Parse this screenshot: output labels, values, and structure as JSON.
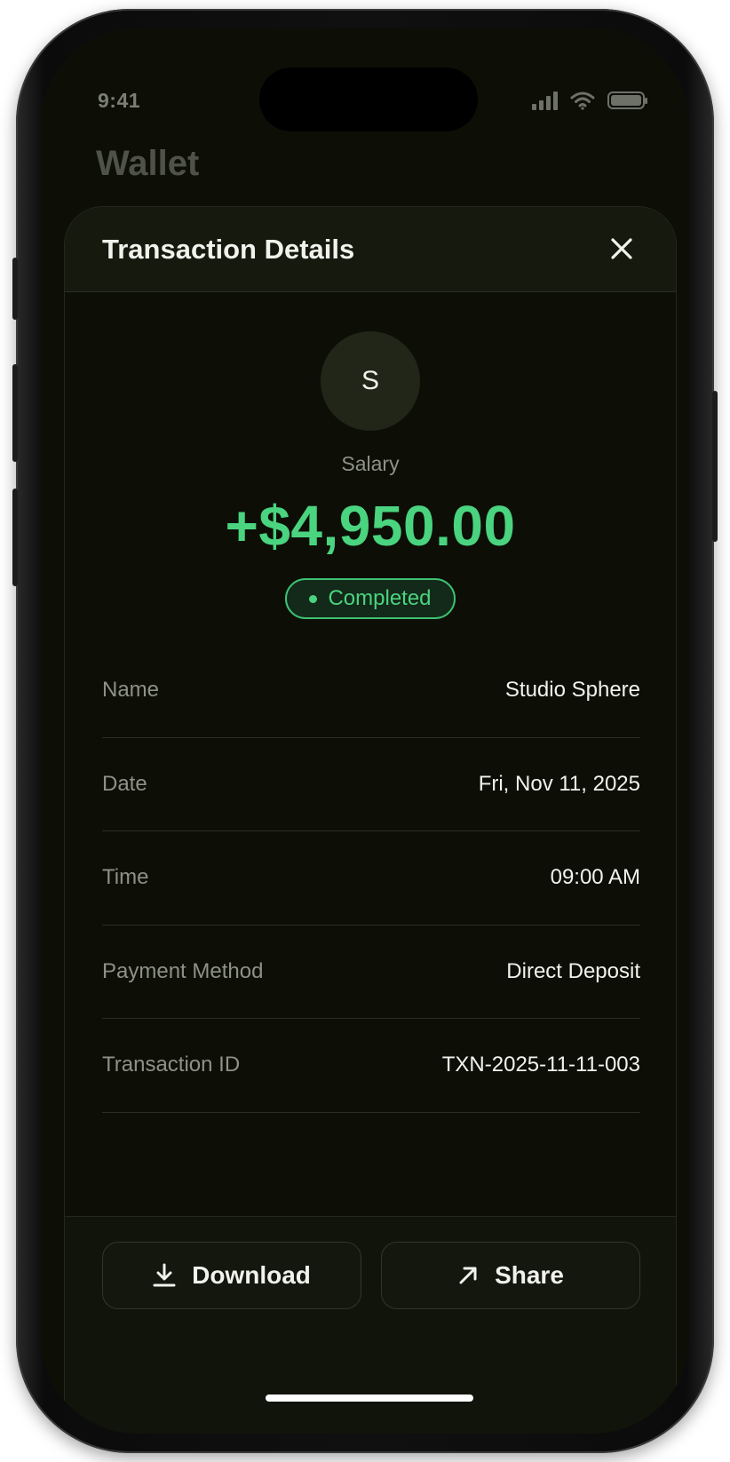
{
  "status_bar": {
    "time": "9:41",
    "icons": [
      "signal-icon",
      "wifi-icon",
      "battery-icon"
    ]
  },
  "background_screen": {
    "title": "Wallet"
  },
  "sheet": {
    "title": "Transaction Details",
    "close_icon": "close-icon"
  },
  "transaction": {
    "avatar_initial": "S",
    "category": "Salary",
    "amount": "+$4,950.00",
    "status": "Completed",
    "details": [
      {
        "label": "Name",
        "value": "Studio Sphere"
      },
      {
        "label": "Date",
        "value": "Fri, Nov 11, 2025"
      },
      {
        "label": "Time",
        "value": "09:00 AM"
      },
      {
        "label": "Payment Method",
        "value": "Direct Deposit"
      },
      {
        "label": "Transaction ID",
        "value": "TXN-2025-11-11-003"
      }
    ]
  },
  "actions": {
    "download_label": "Download",
    "download_icon": "download-icon",
    "share_label": "Share",
    "share_icon": "arrow-up-right-icon"
  },
  "colors": {
    "accent_green": "#4ad47f",
    "background": "#0d0f07",
    "text_primary": "#f2f2ec",
    "text_secondary": "#8e9186"
  }
}
